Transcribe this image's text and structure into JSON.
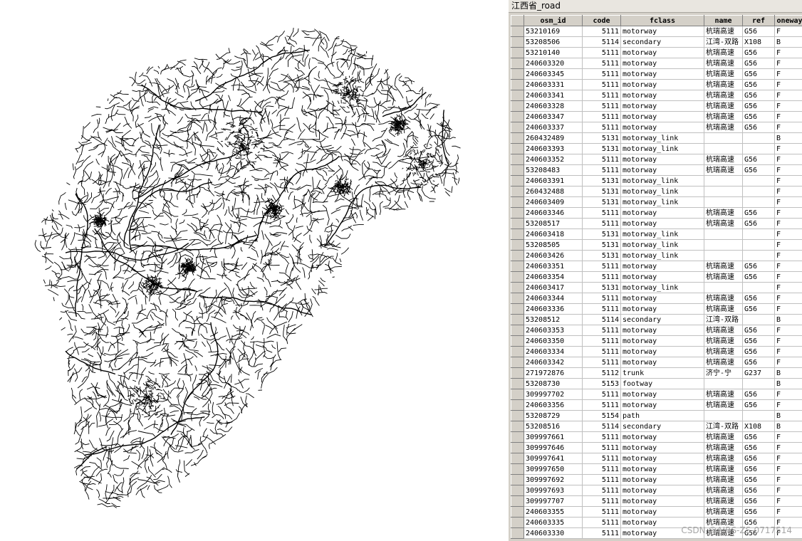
{
  "window": {
    "title": "江西省_road"
  },
  "table": {
    "columns": [
      "osm_id",
      "code",
      "fclass",
      "name",
      "ref",
      "oneway"
    ],
    "rows": [
      [
        "53210169",
        "5111",
        "motorway",
        "杭瑞高速",
        "G56",
        "F"
      ],
      [
        "53208506",
        "5114",
        "secondary",
        "江湾-双路",
        "X108",
        "B"
      ],
      [
        "53210140",
        "5111",
        "motorway",
        "杭瑞高速",
        "G56",
        "F"
      ],
      [
        "240603320",
        "5111",
        "motorway",
        "杭瑞高速",
        "G56",
        "F"
      ],
      [
        "240603345",
        "5111",
        "motorway",
        "杭瑞高速",
        "G56",
        "F"
      ],
      [
        "240603331",
        "5111",
        "motorway",
        "杭瑞高速",
        "G56",
        "F"
      ],
      [
        "240603341",
        "5111",
        "motorway",
        "杭瑞高速",
        "G56",
        "F"
      ],
      [
        "240603328",
        "5111",
        "motorway",
        "杭瑞高速",
        "G56",
        "F"
      ],
      [
        "240603347",
        "5111",
        "motorway",
        "杭瑞高速",
        "G56",
        "F"
      ],
      [
        "240603337",
        "5111",
        "motorway",
        "杭瑞高速",
        "G56",
        "F"
      ],
      [
        "260432489",
        "5131",
        "motorway_link",
        "",
        "",
        "B"
      ],
      [
        "240603393",
        "5131",
        "motorway_link",
        "",
        "",
        "F"
      ],
      [
        "240603352",
        "5111",
        "motorway",
        "杭瑞高速",
        "G56",
        "F"
      ],
      [
        "53208483",
        "5111",
        "motorway",
        "杭瑞高速",
        "G56",
        "F"
      ],
      [
        "240603391",
        "5131",
        "motorway_link",
        "",
        "",
        "F"
      ],
      [
        "260432488",
        "5131",
        "motorway_link",
        "",
        "",
        "F"
      ],
      [
        "240603409",
        "5131",
        "motorway_link",
        "",
        "",
        "F"
      ],
      [
        "240603346",
        "5111",
        "motorway",
        "杭瑞高速",
        "G56",
        "F"
      ],
      [
        "53208517",
        "5111",
        "motorway",
        "杭瑞高速",
        "G56",
        "F"
      ],
      [
        "240603418",
        "5131",
        "motorway_link",
        "",
        "",
        "F"
      ],
      [
        "53208505",
        "5131",
        "motorway_link",
        "",
        "",
        "F"
      ],
      [
        "240603426",
        "5131",
        "motorway_link",
        "",
        "",
        "F"
      ],
      [
        "240603351",
        "5111",
        "motorway",
        "杭瑞高速",
        "G56",
        "F"
      ],
      [
        "240603354",
        "5111",
        "motorway",
        "杭瑞高速",
        "G56",
        "F"
      ],
      [
        "240603417",
        "5131",
        "motorway_link",
        "",
        "",
        "F"
      ],
      [
        "240603344",
        "5111",
        "motorway",
        "杭瑞高速",
        "G56",
        "F"
      ],
      [
        "240603336",
        "5111",
        "motorway",
        "杭瑞高速",
        "G56",
        "F"
      ],
      [
        "53208512",
        "5114",
        "secondary",
        "江湾-双路",
        "",
        "B"
      ],
      [
        "240603353",
        "5111",
        "motorway",
        "杭瑞高速",
        "G56",
        "F"
      ],
      [
        "240603350",
        "5111",
        "motorway",
        "杭瑞高速",
        "G56",
        "F"
      ],
      [
        "240603334",
        "5111",
        "motorway",
        "杭瑞高速",
        "G56",
        "F"
      ],
      [
        "240603342",
        "5111",
        "motorway",
        "杭瑞高速",
        "G56",
        "F"
      ],
      [
        "271972876",
        "5112",
        "trunk",
        "济宁-宁",
        "G237",
        "B"
      ],
      [
        "53208730",
        "5153",
        "footway",
        "",
        "",
        "B"
      ],
      [
        "309997702",
        "5111",
        "motorway",
        "杭瑞高速",
        "G56",
        "F"
      ],
      [
        "240603356",
        "5111",
        "motorway",
        "杭瑞高速",
        "G56",
        "F"
      ],
      [
        "53208729",
        "5154",
        "path",
        "",
        "",
        "B"
      ],
      [
        "53208516",
        "5114",
        "secondary",
        "江湾-双路",
        "X108",
        "B"
      ],
      [
        "309997661",
        "5111",
        "motorway",
        "杭瑞高速",
        "G56",
        "F"
      ],
      [
        "309997646",
        "5111",
        "motorway",
        "杭瑞高速",
        "G56",
        "F"
      ],
      [
        "309997641",
        "5111",
        "motorway",
        "杭瑞高速",
        "G56",
        "F"
      ],
      [
        "309997650",
        "5111",
        "motorway",
        "杭瑞高速",
        "G56",
        "F"
      ],
      [
        "309997692",
        "5111",
        "motorway",
        "杭瑞高速",
        "G56",
        "F"
      ],
      [
        "309997693",
        "5111",
        "motorway",
        "杭瑞高速",
        "G56",
        "F"
      ],
      [
        "309997707",
        "5111",
        "motorway",
        "杭瑞高速",
        "G56",
        "F"
      ],
      [
        "240603355",
        "5111",
        "motorway",
        "杭瑞高速",
        "G56",
        "F"
      ],
      [
        "240603335",
        "5111",
        "motorway",
        "杭瑞高速",
        "G56",
        "F"
      ],
      [
        "240603330",
        "5111",
        "motorway",
        "杭瑞高速",
        "G56",
        "F"
      ]
    ]
  },
  "watermark": "CSDN @AIRS-ZS-0717514",
  "colors": {
    "road_line": "#000000",
    "grid_header_bg": "#d4d0c8",
    "cell_bg": "#ffffff"
  }
}
